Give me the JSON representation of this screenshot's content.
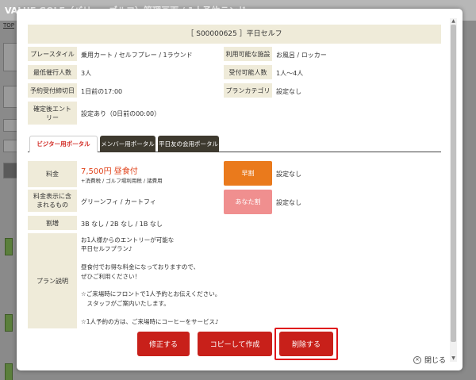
{
  "background": {
    "title": "VALUE GOLF（バリューゴルフ）管理画面 / 1人予約ランド",
    "top_link": "TOP"
  },
  "modal": {
    "plan_header": "［ S00000625 ］平日セルフ",
    "rows": {
      "play_style": {
        "label": "プレースタイル",
        "value": "乗用カート / セルフプレー / 1ラウンド"
      },
      "facilities": {
        "label": "利用可能な施設",
        "value": "お風呂 / ロッカー"
      },
      "min_people": {
        "label": "最低催行人数",
        "value": "3人"
      },
      "accept_people": {
        "label": "受付可能人数",
        "value": "1人〜4人"
      },
      "deadline": {
        "label": "予約受付締切日",
        "value": "1日前の17:00"
      },
      "category": {
        "label": "プランカテゴリ",
        "value": "設定なし"
      },
      "post_entry": {
        "label": "確定後エントリー",
        "value": "設定あり（0日前の00:00）"
      }
    },
    "tabs": [
      "ビジター用ポータル",
      "メンバー用ポータル",
      "平日友の会用ポータル"
    ],
    "fee": {
      "label": "料金",
      "price": "7,500円 昼食付",
      "sub": "+消費税 / ゴルフ場利用税 / 諸費用",
      "early_badge": "早割",
      "early_value": "設定なし",
      "anata_badge": "あなた割",
      "anata_value": "設定なし"
    },
    "included": {
      "label": "料金表示に含まれるもの",
      "value": "グリーンフィ / カートフィ"
    },
    "surcharge": {
      "label": "割増",
      "value": "3B なし / 2B なし / 1B なし"
    },
    "description": {
      "label": "プラン説明",
      "text": "お1人様からのエントリーが可能な\n平日セルフプラン♪\n\n昼食付でお得な料金になっておりますので、\nぜひご利用ください！\n\n☆ご来場時にフロントで1人予約とお伝えください。\n　スタッフがご案内いたします。\n\n☆1人予約の方は、ご来場時にコーヒーをサービス♪"
    },
    "buttons": {
      "edit": "修正する",
      "copy": "コピーして作成",
      "delete": "削除する"
    },
    "close": "閉じる"
  }
}
